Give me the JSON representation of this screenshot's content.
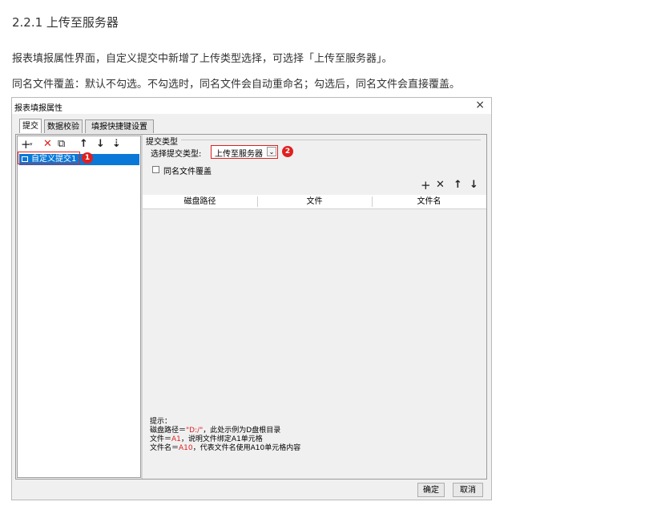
{
  "doc": {
    "heading": "2.2.1 上传至服务器",
    "para1": "报表填报属性界面，自定义提交中新增了上传类型选择，可选择「上传至服务器」。",
    "para2": "同名文件覆盖：默认不勾选。不勾选时，同名文件会自动重命名；勾选后，同名文件会直接覆盖。"
  },
  "dialog": {
    "title": "报表填报属性",
    "close": "×",
    "tabs": [
      "提交",
      "数据校验",
      "填报快捷键设置"
    ],
    "left_toolbar": [
      "+",
      "▾",
      "✕",
      "⧉",
      "↑",
      "↓",
      "⇣"
    ],
    "list": [
      {
        "label": "自定义提交1"
      }
    ],
    "badges": [
      "1",
      "2"
    ],
    "group_label": "提交类型",
    "select_label": "选择提交类型:",
    "select_value": "上传至服务器",
    "checkbox_label": "同名文件覆盖",
    "checkbox_checked": false,
    "right_toolbar": [
      "+",
      "✕",
      "↑",
      "↓"
    ],
    "columns": [
      "磁盘路径",
      "文件",
      "文件名"
    ],
    "hint": {
      "title": "提示：",
      "line1_a": "磁盘路径＝",
      "line1_b": "\"D:/\"",
      "line1_c": "，此处示例为D盘根目录",
      "line2_a": "文件＝",
      "line2_b": "A1",
      "line2_c": "，说明文件绑定A1单元格",
      "line3_a": "文件名＝",
      "line3_b": "A10",
      "line3_c": "，代表文件名使用A10单元格内容"
    },
    "ok": "确定",
    "cancel": "取消",
    "accent_red": "#e0201f",
    "selection_blue": "#0a78d7"
  }
}
